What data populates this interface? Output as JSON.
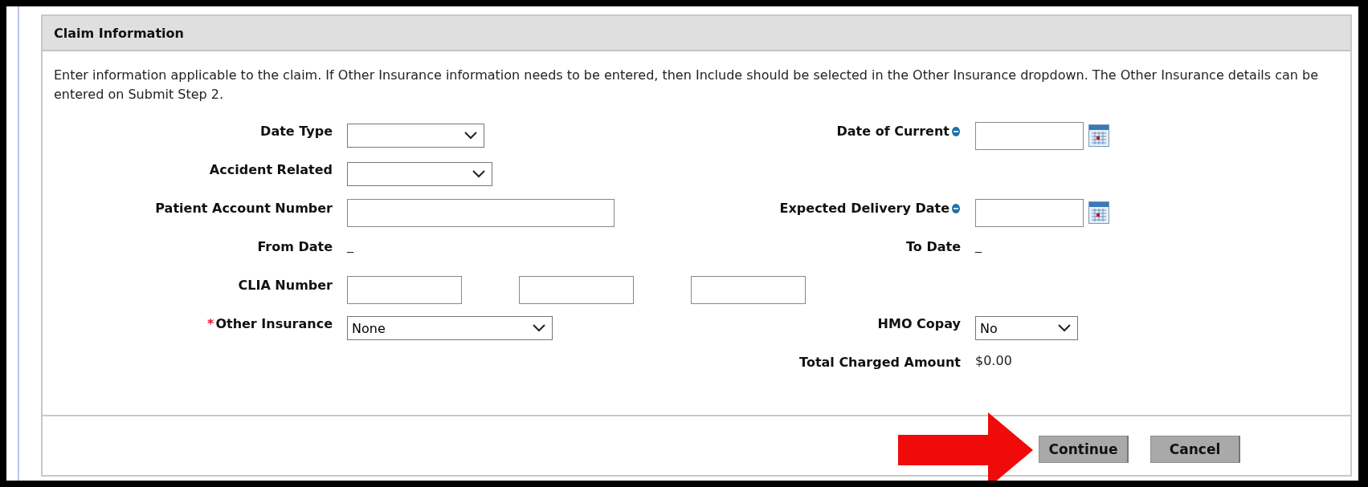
{
  "panel": {
    "title": "Claim Information",
    "instructions": "Enter information applicable to the claim. If Other Insurance information needs to be entered, then Include should be selected in the Other Insurance dropdown. The Other Insurance details can be entered on Submit Step 2.",
    "rows": [
      {
        "kind": "pair",
        "left": {
          "label": "Date Type",
          "kind": "select"
        },
        "right": {
          "label": "Date of Current",
          "kind": "date",
          "info": true
        }
      },
      {
        "kind": "pair",
        "left": {
          "label": "Accident Related",
          "kind": "select"
        }
      },
      {
        "kind": "pair",
        "left": {
          "label": "Patient Account Number",
          "kind": "input"
        },
        "right": {
          "label": "Expected Delivery Date",
          "kind": "date",
          "info": true
        }
      },
      {
        "kind": "pair",
        "left": {
          "label": "From Date",
          "kind": "text",
          "value": "_"
        },
        "right": {
          "label": "To Date",
          "kind": "text",
          "value": "_"
        }
      },
      {
        "kind": "triple",
        "left": {
          "label": "CLIA Number",
          "kind": "triple_input"
        }
      },
      {
        "kind": "pair",
        "left": {
          "label": "Other Insurance",
          "required_mark": "*",
          "kind": "select",
          "value": "None"
        },
        "right": {
          "label": "HMO Copay",
          "kind": "select",
          "value": "No"
        }
      },
      {
        "kind": "total",
        "right": {
          "label": "Total Charged Amount",
          "kind": "text",
          "value": "$0.00"
        }
      }
    ],
    "buttons": [
      {
        "label": "Continue",
        "highlighted": true
      },
      {
        "label": "Cancel",
        "highlighted": false
      }
    ]
  }
}
